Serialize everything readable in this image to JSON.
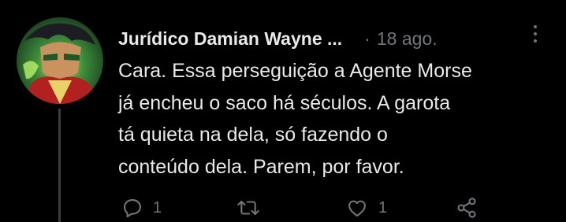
{
  "tweet": {
    "author_name": "Jurídico Damian Wayne ...",
    "separator": "·",
    "timestamp": "18 ago.",
    "text": "Cara. Essa perseguição a Agente Morse\njá encheu o saco há séculos. A garota\ntá quieta na dela, só fazendo o\nconteúdo dela. Parem, por favor.",
    "avatar_icon": "avatar-image",
    "more_icon": "more-vertical-icon"
  },
  "actions": {
    "reply": {
      "icon": "reply-icon",
      "count": "1"
    },
    "retweet": {
      "icon": "retweet-icon",
      "count": ""
    },
    "like": {
      "icon": "heart-icon",
      "count": "1"
    },
    "share": {
      "icon": "share-icon",
      "count": ""
    }
  },
  "colors": {
    "background": "#000000",
    "primary_text": "#e7e9ea",
    "secondary_text": "#71767b",
    "thread_line": "#3a3d40"
  }
}
